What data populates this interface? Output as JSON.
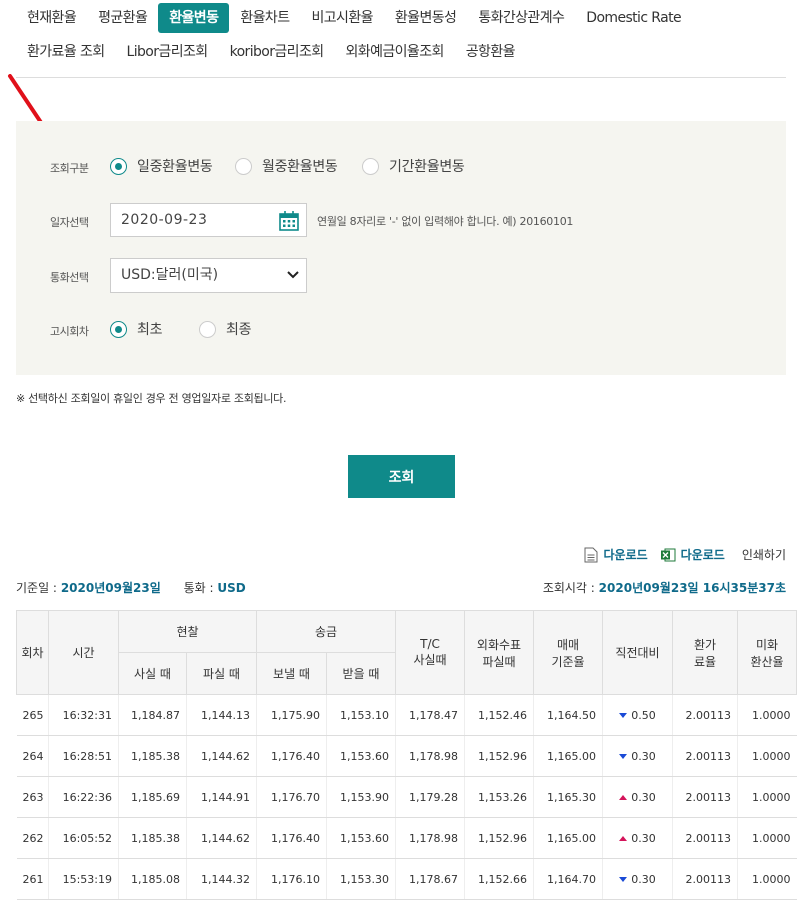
{
  "tabs_row1": [
    {
      "label": "현재환율",
      "active": false
    },
    {
      "label": "평균환율",
      "active": false
    },
    {
      "label": "환율변동",
      "active": true
    },
    {
      "label": "환율차트",
      "active": false
    },
    {
      "label": "비고시환율",
      "active": false
    },
    {
      "label": "환율변동성",
      "active": false
    },
    {
      "label": "통화간상관계수",
      "active": false
    },
    {
      "label": "Domestic Rate",
      "active": false
    }
  ],
  "tabs_row2": [
    {
      "label": "환가료율 조회"
    },
    {
      "label": "Libor금리조회"
    },
    {
      "label": "koribor금리조회"
    },
    {
      "label": "외화예금이율조회"
    },
    {
      "label": "공항환율"
    }
  ],
  "form": {
    "query_type_label": "조회구분",
    "query_types": [
      "일중환율변동",
      "월중환율변동",
      "기간환율변동"
    ],
    "date_label": "일자선택",
    "date_value": "2020-09-23",
    "date_hint": "연월일 8자리로 '-' 없이 입력해야 합니다. 예) 20160101",
    "currency_label": "통화선택",
    "currency_value": "USD:달러(미국)",
    "notice_label": "고시회차",
    "notice_options": [
      "최초",
      "최종"
    ]
  },
  "notice_text": "※ 선택하신 조회일이 휴일인 경우 전 영업일자로 조회됩니다.",
  "search_button": "조회",
  "tools": {
    "download1": "다운로드",
    "download2": "다운로드",
    "print": "인쇄하기"
  },
  "info": {
    "base_date_label": "기준일 :",
    "base_date": "2020년09월23일",
    "currency_label": "통화 :",
    "currency": "USD",
    "query_time_label": "조회시각 :",
    "query_time": "2020년09월23일 16시35분37초"
  },
  "table": {
    "headers": {
      "round": "회차",
      "time": "시간",
      "cash": "현찰",
      "cash_buy": "사실 때",
      "cash_sell": "파실 때",
      "wire": "송금",
      "wire_send": "보낼 때",
      "wire_recv": "받을 때",
      "tc_1": "T/C",
      "tc_2": "사실때",
      "check_1": "외화수표",
      "check_2": "파실때",
      "base_1": "매매",
      "base_2": "기준율",
      "change": "직전대비",
      "fee_1": "환가",
      "fee_2": "료율",
      "usd_1": "미화",
      "usd_2": "환산율"
    },
    "rows": [
      [
        "265",
        "16:32:31",
        "1,184.87",
        "1,144.13",
        "1,175.90",
        "1,153.10",
        "1,178.47",
        "1,152.46",
        "1,164.50",
        "down",
        "0.50",
        "2.00113",
        "1.0000"
      ],
      [
        "264",
        "16:28:51",
        "1,185.38",
        "1,144.62",
        "1,176.40",
        "1,153.60",
        "1,178.98",
        "1,152.96",
        "1,165.00",
        "down",
        "0.30",
        "2.00113",
        "1.0000"
      ],
      [
        "263",
        "16:22:36",
        "1,185.69",
        "1,144.91",
        "1,176.70",
        "1,153.90",
        "1,179.28",
        "1,153.26",
        "1,165.30",
        "up",
        "0.30",
        "2.00113",
        "1.0000"
      ],
      [
        "262",
        "16:05:52",
        "1,185.38",
        "1,144.62",
        "1,176.40",
        "1,153.60",
        "1,178.98",
        "1,152.96",
        "1,165.00",
        "up",
        "0.30",
        "2.00113",
        "1.0000"
      ],
      [
        "261",
        "15:53:19",
        "1,185.08",
        "1,144.32",
        "1,176.10",
        "1,153.30",
        "1,178.67",
        "1,152.66",
        "1,164.70",
        "down",
        "0.30",
        "2.00113",
        "1.0000"
      ]
    ]
  },
  "colors": {
    "accent": "#0f8a8a",
    "up": "#d4145a",
    "down": "#1a4ad6",
    "annotation_arrow": "#e0101a"
  }
}
